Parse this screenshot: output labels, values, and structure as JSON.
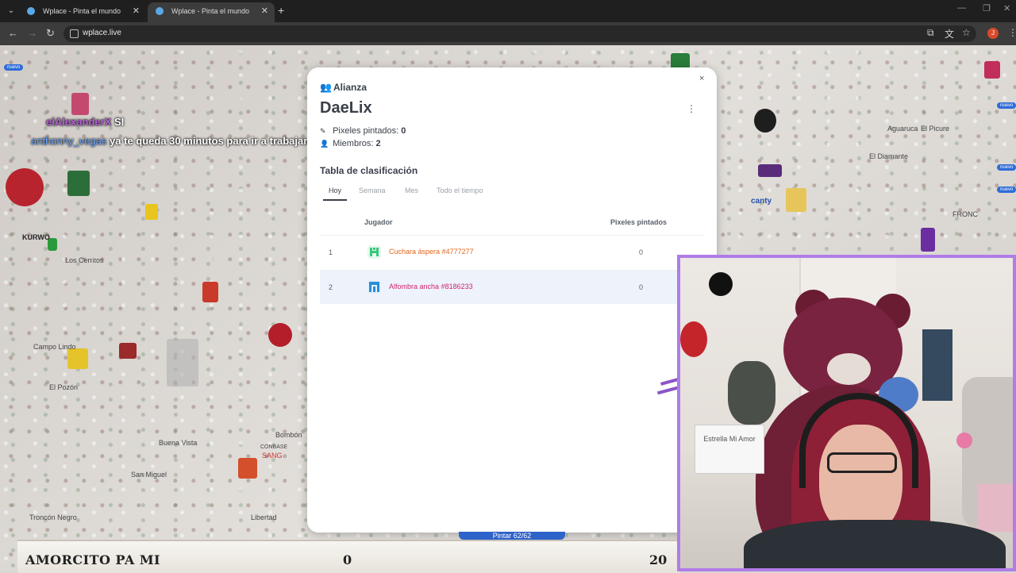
{
  "browser": {
    "tabs": [
      {
        "title": "Wplace - Pinta el mundo"
      },
      {
        "title": "Wplace - Pinta el mundo"
      }
    ],
    "new_tab_label": "+",
    "address": "wplace.live",
    "profile_initial": "J"
  },
  "map": {
    "places": [
      "Los Cerritos",
      "Campo Lindo",
      "El Pozón",
      "Buena Vista",
      "San Miguel",
      "Troncón Negro",
      "Libertad",
      "Bombón",
      "Aguaruca",
      "El Picure",
      "El Diamante",
      "FRONC",
      "KURWO",
      "SANG",
      "CONBASE",
      "canty",
      "nuevo"
    ],
    "chat": [
      {
        "user": "elAlexanderX",
        "message": "SI"
      },
      {
        "user": "anthonny_vegas",
        "message": "ya te queda 30 minutos para ir a trabajar"
      }
    ]
  },
  "modal": {
    "section": "Alianza",
    "name": "DaeLix",
    "close": "×",
    "menu": "⋮",
    "pixels_label": "Pixeles pintados:",
    "pixels_value": "0",
    "members_label": "Miembros:",
    "members_value": "2",
    "leaderboard_title": "Tabla de clasificación",
    "period_tabs": [
      "Hoy",
      "Semana",
      "Mes",
      "Todo el tiempo"
    ],
    "columns": {
      "player": "Jugador",
      "pixels": "Pixeles pintados"
    },
    "rows": [
      {
        "rank": "1",
        "name": "Cuchara áspera",
        "id": "#4777277",
        "pixels": "0",
        "color": "#e0661f",
        "avatar_color": "#35c97a"
      },
      {
        "rank": "2",
        "name": "Alfombra ancha",
        "id": "#8186233",
        "pixels": "0",
        "color": "#d0246b",
        "avatar_color": "#2a8ed8"
      }
    ]
  },
  "pintar": {
    "label": "Pintar 62/62"
  },
  "ticker": {
    "name": "AMORCITO PA MI",
    "value_a": "0",
    "value_b": "20"
  },
  "webcam": {
    "sign_text": "Estrella Mi Amor"
  },
  "colors": {
    "accent": "#3a3f4a",
    "webcam_border": "#b07ce8",
    "pintar": "#2e63c9"
  }
}
